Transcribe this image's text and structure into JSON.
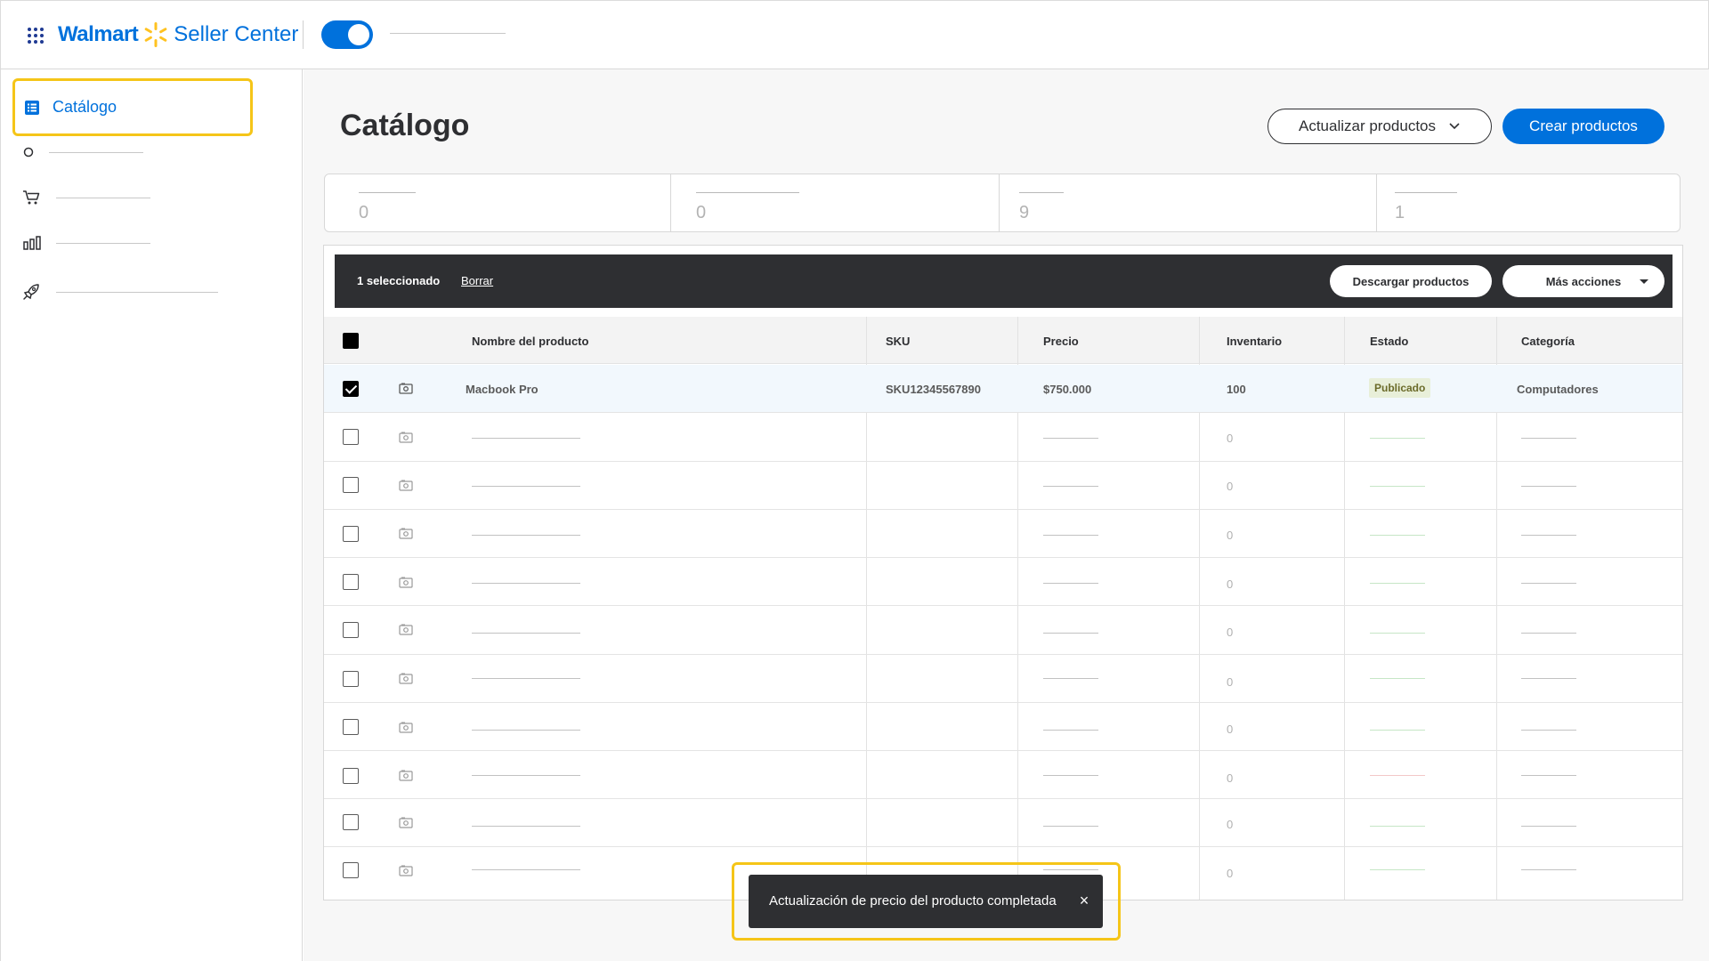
{
  "brand": {
    "walmart": "Walmart",
    "seller": "Seller Center"
  },
  "colors": {
    "accent": "#0071dc",
    "highlight": "#f5c518",
    "dark": "#2e2f32"
  },
  "sidebar": {
    "active": {
      "label": "Catálogo",
      "icon": "catalog-list-icon"
    },
    "items": [
      {
        "icon": "circle-icon"
      },
      {
        "icon": "cart-icon"
      },
      {
        "icon": "bar-chart-icon"
      },
      {
        "icon": "rocket-icon"
      }
    ]
  },
  "page": {
    "title": "Catálogo",
    "update_button": "Actualizar productos",
    "create_button": "Crear productos"
  },
  "stats": [
    "0",
    "0",
    "9",
    "1"
  ],
  "selection": {
    "count": "1 seleccionado",
    "clear": "Borrar",
    "download": "Descargar productos",
    "more": "Más acciones"
  },
  "table": {
    "headers": {
      "name": "Nombre del producto",
      "sku": "SKU",
      "price": "Precio",
      "inventory": "Inventario",
      "status": "Estado",
      "category": "Categoría"
    },
    "first_row": {
      "name": "Macbook Pro",
      "sku": "SKU12345567890",
      "price": "$750.000",
      "inventory": "100",
      "status": "Publicado",
      "category": "Computadores"
    },
    "placeholder_inventory": "0"
  },
  "toast": {
    "message": "Actualización de precio del producto completada"
  }
}
